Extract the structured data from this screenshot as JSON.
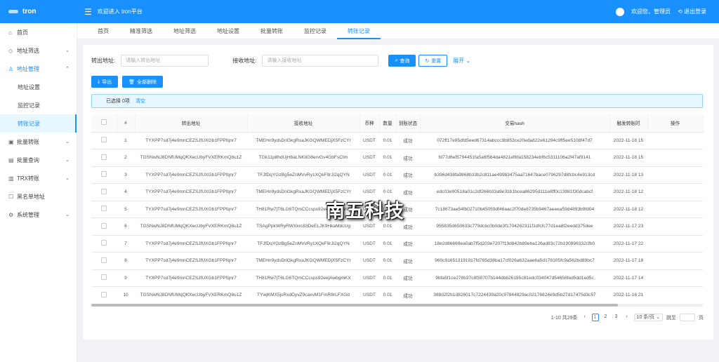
{
  "app": {
    "logo": "tron",
    "welcome": "欢迎进入 tron平台",
    "user": "欢迎您，管理员",
    "logout": "退出登录"
  },
  "sidebar": {
    "items": [
      {
        "label": "首页",
        "icon": "home-icon",
        "arrow": ""
      },
      {
        "label": "地址筛选",
        "icon": "tag-icon",
        "arrow": "⌄"
      },
      {
        "label": "地址管理",
        "icon": "user-icon",
        "arrow": "⌃"
      },
      {
        "label": "地址设置",
        "icon": "",
        "arrow": ""
      },
      {
        "label": "监控记录",
        "icon": "",
        "arrow": ""
      },
      {
        "label": "转账记录",
        "icon": "",
        "arrow": ""
      },
      {
        "label": "批量转账",
        "icon": "transfer-icon",
        "arrow": "⌄"
      },
      {
        "label": "批量查询",
        "icon": "query-icon",
        "arrow": "⌄"
      },
      {
        "label": "TRX转账",
        "icon": "trx-icon",
        "arrow": "⌄"
      },
      {
        "label": "黑名单地址",
        "icon": "blacklist-icon",
        "arrow": ""
      },
      {
        "label": "系统管理",
        "icon": "gear-icon",
        "arrow": "⌄"
      }
    ]
  },
  "tabs": [
    "首页",
    "精准筛选",
    "地址筛选",
    "地址设置",
    "批量转账",
    "监控记录",
    "转账记录"
  ],
  "filters": {
    "from_label": "转出地址:",
    "from_placeholder": "请输入转出地址",
    "to_label": "接收地址:",
    "to_placeholder": "请输入接收地址",
    "search": "查询",
    "reset": "重置",
    "expand": "展开"
  },
  "actions": {
    "export": "导出",
    "delete_all": "全部删除"
  },
  "selection": {
    "text": "已选择 0项",
    "clear": "清空"
  },
  "table": {
    "headers": [
      "#",
      "转出地址",
      "接收地址",
      "币种",
      "数量",
      "到账状态",
      "交易hash",
      "触发转账时",
      "操作"
    ],
    "rows": [
      [
        "1",
        "TYXPP7sd7j4e9mnCEZSJfUXGb1FPPfqnr7",
        "TMEHn9ydsDriGkgRxaJKGQWMEDjX5FzCYr",
        "USDT",
        "0.01",
        "成功",
        "072ff17e85dfd5eed67314abccc9b853ce20eda822e61294c9ff5ee5108f47d7",
        "2022-11-18 15"
      ],
      [
        "2",
        "TGSNwNJ8DNfUMqQKXecUbyFVXERKmQ8u1Z",
        "TGk11p8hdUjHbaLNKitG8ervGv4GbFsCtm",
        "USDT",
        "0.01",
        "成功",
        "fd77d6ef5794451fa5a6f564da4821ef6fa158234ebf6c5311106a2f47af9141",
        "2022-11-18 15"
      ],
      [
        "3",
        "TYXPP7sd7j4e9mnCEZSJfUXGb1FPPfqnr7",
        "TFJfDqYGzBg5eZnMVvRy1XQkF9rJi2qQYN",
        "USDT",
        "0.01",
        "成功",
        "b396d438fa9868b33b2c811ae49983475aa71647bace0796297d8fcbc4e913cd",
        "2022-11-18 13"
      ],
      [
        "4",
        "TYXPP7sd7j4e9mnCEZSJfUXGb1FPPfqnr7",
        "TMEHn9ydsDriGkgRxaJKGQWMEDjX5FzCYr",
        "USDT",
        "0.01",
        "成功",
        "edc03e90518a01c2df266b33a9e31b1bcea86295d111e8ff0c13981f30dcabcf",
        "2022-11-18 12"
      ],
      [
        "5",
        "TYXPP7sd7j4e9mnCEZSJfUXGb1FPPfqnr7",
        "TH81Rw7jT6LG6TQmCCcsps92eejAwbgmKX",
        "USDT",
        "0.01",
        "成功",
        "7c18673ae54fb02710b45059df46aac2f70de8735b9467aeeea59d4893b9fd04",
        "2022-11-18 12"
      ],
      [
        "6",
        "TGSNwNJ8DNfUMqQKXecUbyFVXERKmQ8u1Z",
        "TSAgPpkWRyRWXkrc83DeELJK9HkaMdcUg",
        "USDT",
        "0.01",
        "成功",
        "955835d650633c779dcbc0b0de3f1704262311f1dfcfc77d1ea8f2eedd375dee",
        "2022-11-17 23"
      ],
      [
        "7",
        "TYXPP7sd7j4e9mnCEZSJfUXGb1FPPfqnr7",
        "TFJfDqYGzBg5eZnMVvRy1XQkF9rJi2qQYN",
        "USDT",
        "0.01",
        "成功",
        "18e2d86669ea0ab7f5d203e7207f19d842b89eba126ad83c72b190896332cfb0",
        "2022-11-17 22"
      ],
      [
        "8",
        "TYXPP7sd7j4e9mnCEZSJfUXGb1FPPfqnr7",
        "TMEHn9ydsDriGkgRxaJKGQWMEDjX5FzCYr",
        "USDT",
        "0.01",
        "成功",
        "960c916513191917fd765d38ba17cf026a632aae6a5d178105fc9a562bd89bc7",
        "2022-11-17 18"
      ],
      [
        "9",
        "TYXPP7sd7j4e9mnCEZSJfUXGb1FPPfqnr7",
        "TH81Rw7jT6LG6TQmCCcsps92eejAwbgmKX",
        "USDT",
        "0.01",
        "成功",
        "9bfa5f1ce278b37c8f30707b144dbb26155c81edc034047d54658fed5dd1ed5c",
        "2022-11-17 14"
      ],
      [
        "10",
        "TGSNwNJ8DNfUMqQKXecUbyFVXERKmQ8u1Z",
        "TYwjKMX5jsRxdDyvZ9caxvM1FmR8rLFXGd",
        "USDT",
        "0.01",
        "成功",
        "388d2f2b1d826017c7224439a20c97844829ac02176824e9d5b27d17475d3c57",
        "2022-11-16 21"
      ]
    ]
  },
  "pagination": {
    "summary": "1-10 共29条",
    "prev": "‹",
    "pages": [
      "1",
      "2",
      "3"
    ],
    "next": "›",
    "page_size": "10 条/页 ⌄",
    "goto": "跳至",
    "page_unit": "页"
  },
  "watermark": "南五科技"
}
